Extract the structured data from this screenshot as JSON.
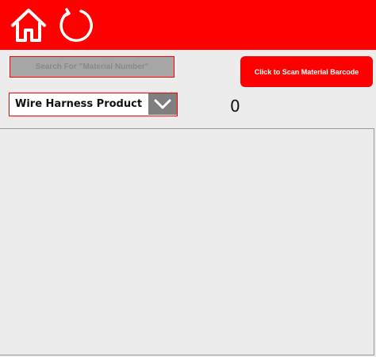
{
  "header": {
    "background_color": "#ff0000",
    "home_icon": "home-icon",
    "refresh_icon": "refresh-icon"
  },
  "search": {
    "placeholder": "Search For \"Material Number\"",
    "value": ""
  },
  "scan_button": {
    "label": "Click to Scan Material Barcode"
  },
  "product_dropdown": {
    "selected": "Wire Harness Product",
    "icon": "chevron-down-icon"
  },
  "count": "0"
}
